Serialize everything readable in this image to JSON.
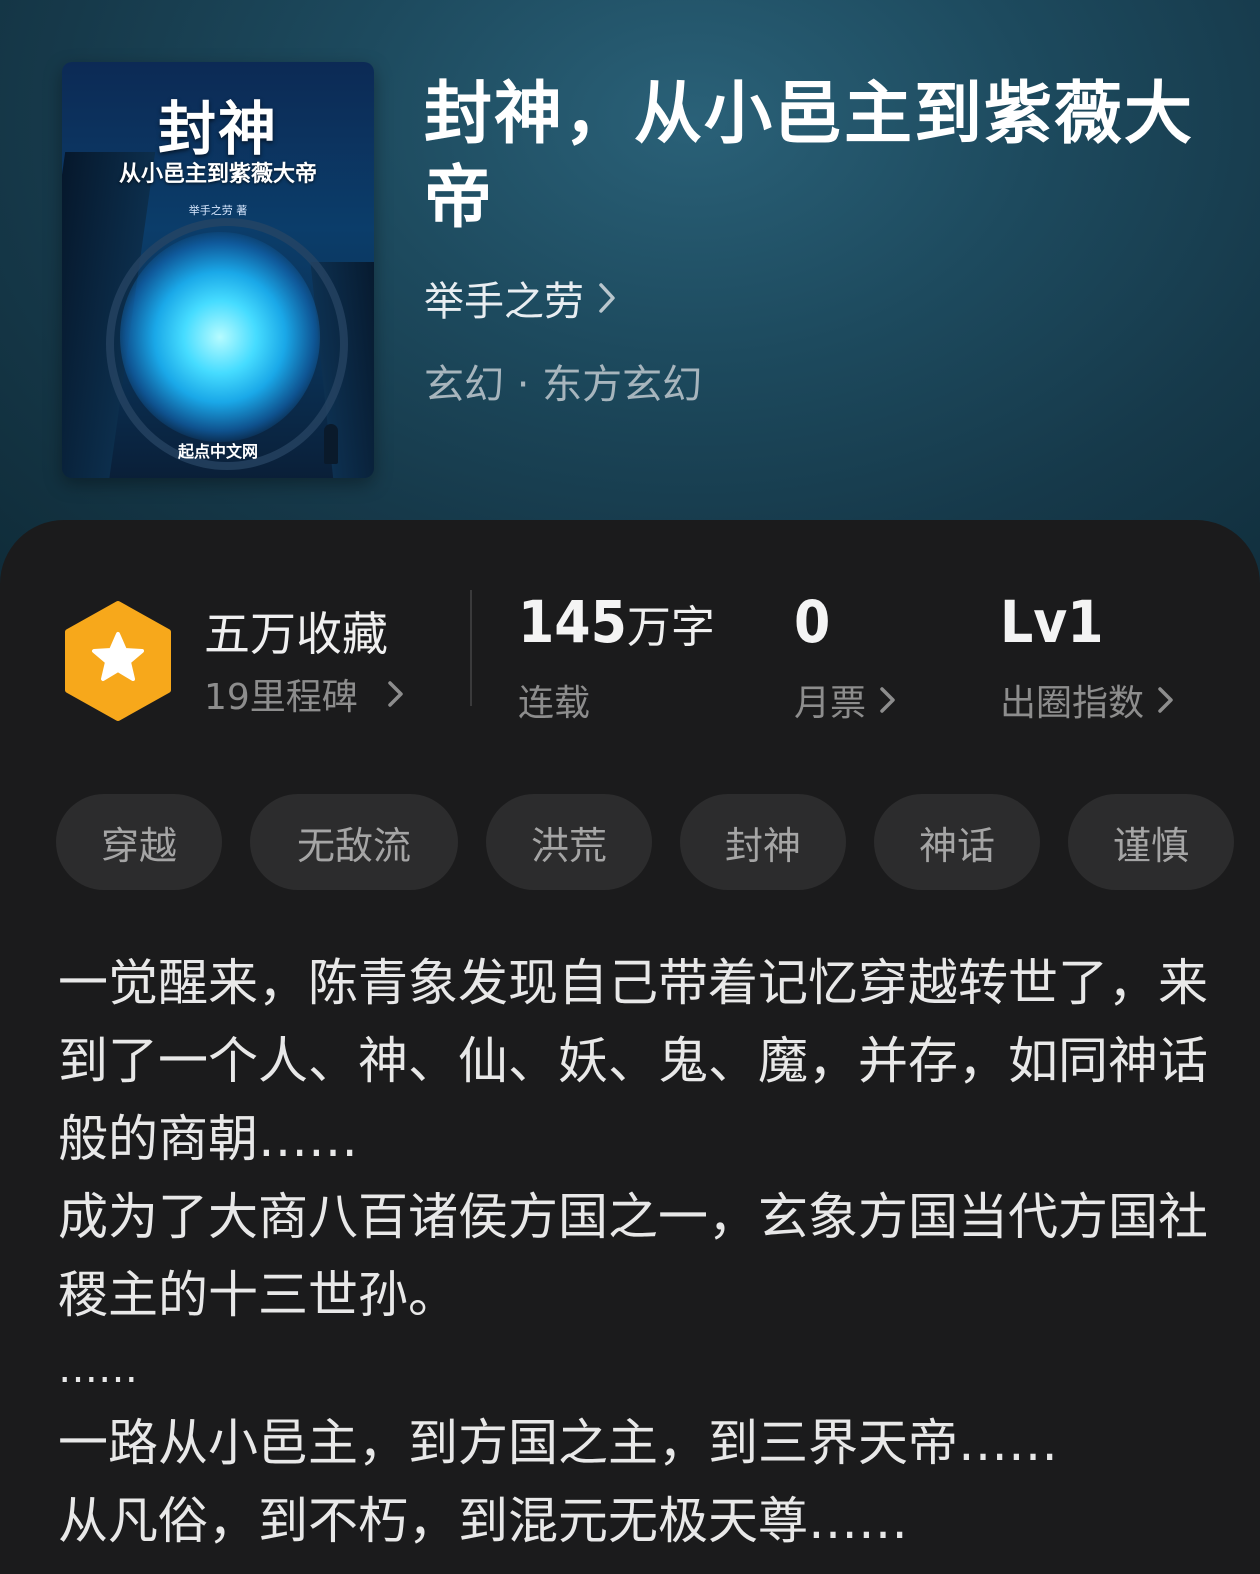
{
  "book": {
    "cover": {
      "title": "封神",
      "subtitle": "从小邑主到紫薇大帝",
      "author_line": "举手之劳 著",
      "publisher": "起点中文网"
    },
    "title": "封神，从小邑主到紫薇大帝",
    "author": "举手之劳",
    "genre": "玄幻 · 东方玄幻"
  },
  "stats": {
    "collection": {
      "label": "五万收藏",
      "milestone": "19里程碑"
    },
    "words": {
      "number": "145",
      "unit": "万字",
      "status": "连载"
    },
    "monthly_ticket": {
      "value": "0",
      "label": "月票"
    },
    "influence": {
      "value": "Lv1",
      "label": "出圈指数"
    }
  },
  "tags": [
    "穿越",
    "无敌流",
    "洪荒",
    "封神",
    "神话",
    "谨慎"
  ],
  "synopsis": [
    "一觉醒来，陈青象发现自己带着记忆穿越转世了，来到了一个人、神、仙、妖、鬼、魔，并存，如同神话般的商朝……",
    "成为了大商八百诸侯方国之一，玄象方国当代方国社稷主的十三世孙。",
    "……",
    "一路从小邑主，到方国之主，到三界天帝……",
    "从凡俗，到不朽，到混元无极天尊……"
  ],
  "colors": {
    "header_bg": "#1d4a5e",
    "panel_bg": "#1b1b1c",
    "badge": "#f7a81b",
    "tag_bg": "#2c2c2d"
  }
}
